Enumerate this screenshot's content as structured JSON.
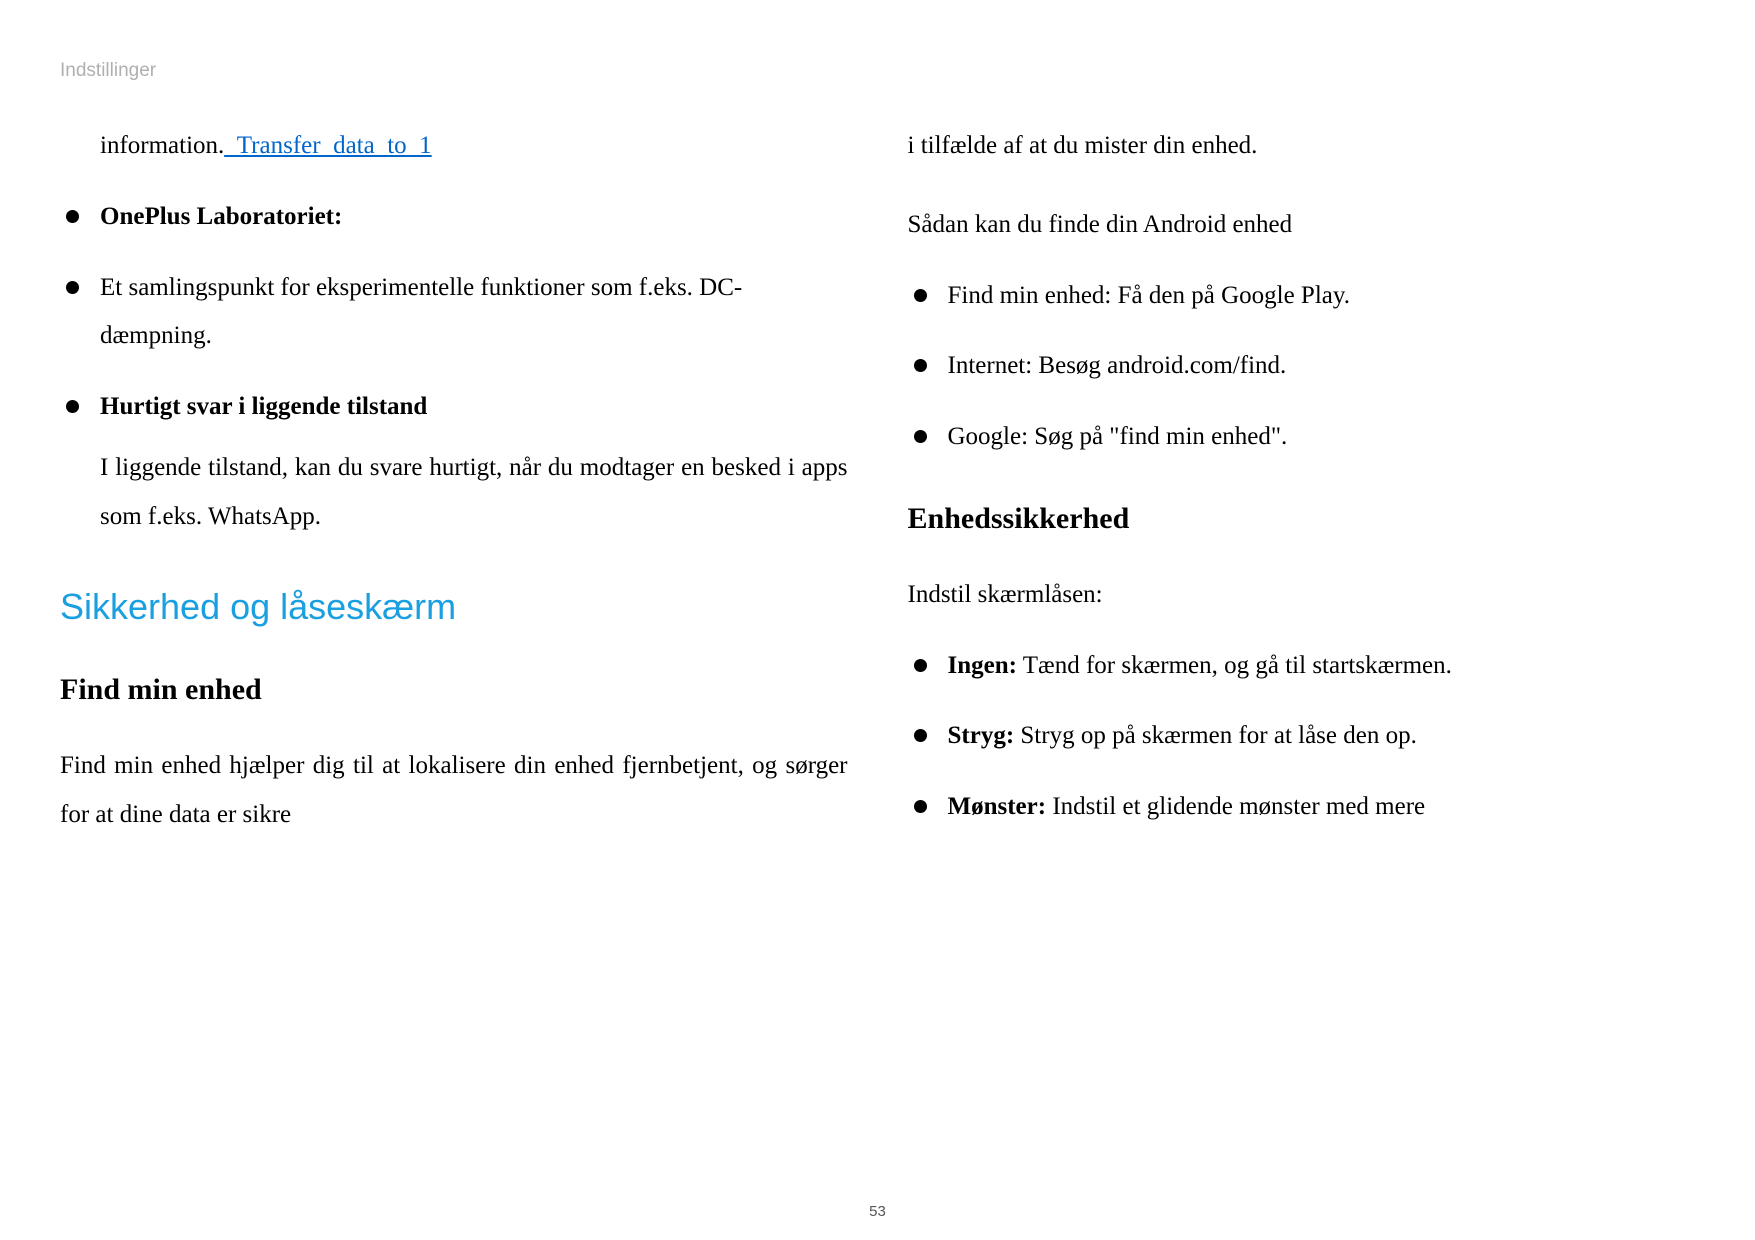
{
  "header": {
    "title": "Indstillinger"
  },
  "page_number": "53",
  "left": {
    "information_prefix": "information.",
    "transfer_link": "_Transfer_data_to_1",
    "oneplus_lab_header": "OnePlus Laboratoriet:",
    "oneplus_lab_desc": "Et samlingspunkt for eksperimentelle funktioner som f.eks. DC-dæmpning.",
    "quick_reply_header": "Hurtigt svar i liggende tilstand",
    "quick_reply_desc": "I liggende tilstand, kan du svare hurtigt, når du modtager en besked i apps som f.eks. WhatsApp.",
    "section_heading": "Sikkerhed og låseskærm",
    "find_device_heading": "Find min enhed",
    "find_device_paragraph": "Find min enhed hjælper dig til at lokalisere din enhed fjernbetjent, og sørger for at dine data er sikre"
  },
  "right": {
    "continuation": "i tilfælde af at du mister din enhed.",
    "find_android_intro": "Sådan kan du finde din Android enhed",
    "find_methods": [
      "Find min enhed: Få den på Google Play.",
      "Internet: Besøg android.com/find.",
      "Google: Søg på \"find min enhed\"."
    ],
    "device_security_heading": "Enhedssikkerhed",
    "screen_lock_intro": "Indstil skærmlåsen:",
    "lock_options": [
      {
        "label": "Ingen:",
        "desc": " Tænd for skærmen, og gå til startskærmen."
      },
      {
        "label": "Stryg:",
        "desc": " Stryg op på skærmen for at låse den op."
      },
      {
        "label": "Mønster:",
        "desc": " Indstil et glidende mønster med mere"
      }
    ]
  }
}
